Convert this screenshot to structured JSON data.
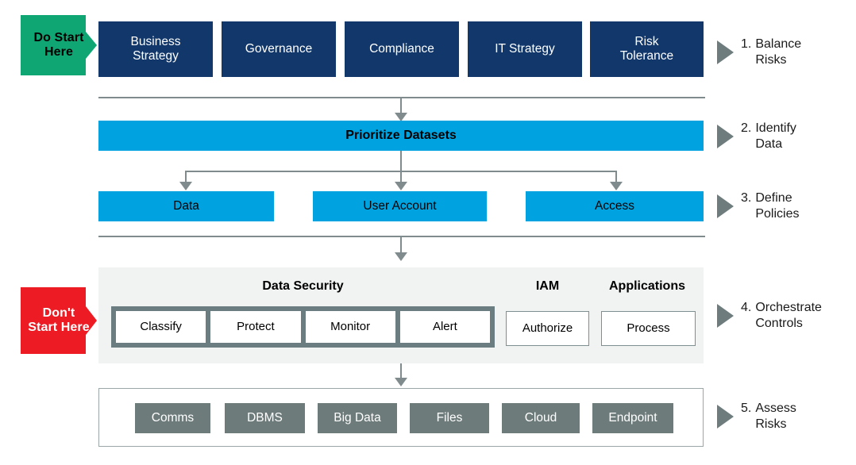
{
  "callouts": {
    "do": {
      "label": "Do\nStart\nHere",
      "color": "#0fa673"
    },
    "dont": {
      "label": "Don't\nStart\nHere",
      "color": "#ed1c24"
    }
  },
  "rows": {
    "row1": {
      "items": [
        {
          "label": "Business\nStrategy"
        },
        {
          "label": "Governance"
        },
        {
          "label": "Compliance"
        },
        {
          "label": "IT Strategy"
        },
        {
          "label": "Risk\nTolerance"
        }
      ],
      "color": "#12386b"
    },
    "row2": {
      "label": "Prioritize Datasets",
      "color": "#00a3e0"
    },
    "row3": {
      "items": [
        {
          "label": "Data"
        },
        {
          "label": "User Account"
        },
        {
          "label": "Access"
        }
      ],
      "color": "#00a3e0"
    },
    "row4": {
      "groups": [
        {
          "title": "Data Security",
          "framed": true,
          "items": [
            {
              "label": "Classify"
            },
            {
              "label": "Protect"
            },
            {
              "label": "Monitor"
            },
            {
              "label": "Alert"
            }
          ]
        },
        {
          "title": "IAM",
          "framed": false,
          "items": [
            {
              "label": "Authorize"
            }
          ]
        },
        {
          "title": "Applications",
          "framed": false,
          "items": [
            {
              "label": "Process"
            }
          ]
        }
      ]
    },
    "row5": {
      "items": [
        {
          "label": "Comms"
        },
        {
          "label": "DBMS"
        },
        {
          "label": "Big Data"
        },
        {
          "label": "Files"
        },
        {
          "label": "Cloud"
        },
        {
          "label": "Endpoint"
        }
      ],
      "color": "#6d7b7b"
    }
  },
  "steps": [
    {
      "num": "1.",
      "label": "Balance\nRisks"
    },
    {
      "num": "2.",
      "label": "Identify\nData"
    },
    {
      "num": "3.",
      "label": "Define\nPolicies"
    },
    {
      "num": "4.",
      "label": "Orchestrate\nControls"
    },
    {
      "num": "5.",
      "label": "Assess\nRisks"
    }
  ],
  "connector_color": "#808b8d"
}
